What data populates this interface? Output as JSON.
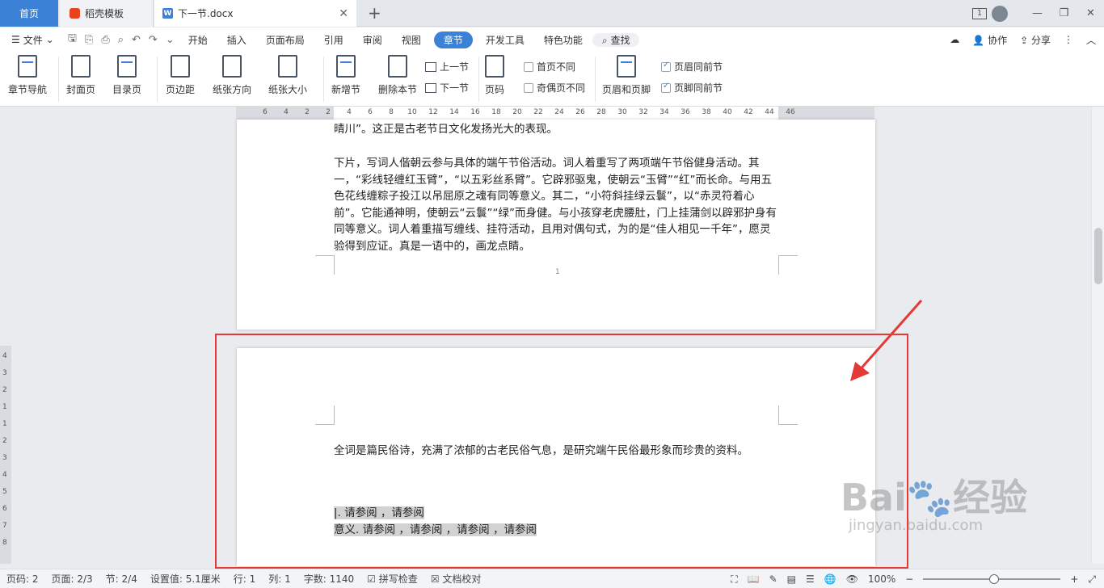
{
  "tabs": {
    "home": "首页",
    "docer": "稻壳模板",
    "doc": "下一节.docx",
    "close": "✕",
    "add": "+"
  },
  "window": {
    "badge": "1",
    "minimize": "—",
    "restore": "❐",
    "close": "✕"
  },
  "menu": {
    "file": "文件",
    "items": [
      "开始",
      "插入",
      "页面布局",
      "引用",
      "审阅",
      "视图",
      "章节",
      "开发工具",
      "特色功能"
    ],
    "search": "查找",
    "collab": "协作",
    "share": "分享",
    "more": "⋮",
    "collapse": "︿"
  },
  "ribbon": {
    "section_nav": "章节导航",
    "cover": "封面页",
    "toc": "目录页",
    "margins": "页边距",
    "orientation": "纸张方向",
    "size": "纸张大小",
    "new_section": "新增节",
    "delete_section": "删除本节",
    "prev_section": "上一节",
    "next_section": "下一节",
    "page_number": "页码",
    "first_page_diff": "首页不同",
    "odd_even_diff": "奇偶页不同",
    "header_footer": "页眉和页脚",
    "header_same": "页眉同前节",
    "footer_same": "页脚同前节"
  },
  "ruler": {
    "numbers": [
      "6",
      "4",
      "2",
      "2",
      "4",
      "6",
      "8",
      "10",
      "12",
      "14",
      "16",
      "18",
      "20",
      "22",
      "24",
      "26",
      "28",
      "30",
      "32",
      "34",
      "36",
      "38",
      "40",
      "42",
      "44",
      "46"
    ],
    "vertical": [
      "4",
      "3",
      "2",
      "1",
      "1",
      "2",
      "3",
      "4",
      "5",
      "6",
      "7",
      "8"
    ]
  },
  "document": {
    "top_fragment": "晴川”。这正是古老节日文化发扬光大的表现。",
    "paragraph": "下片，写词人偕朝云参与具体的端午节俗活动。词人着重写了两项端午节俗健身活动。其一，“彩线轻缠红玉臂”，“以五彩丝系臂”。它辟邪驱鬼，使朝云“玉臂”“红”而长命。与用五色花线缠粽子投江以吊屈原之魂有同等意义。其二，“小符斜挂绿云鬟”，以“赤灵符着心前”。它能通神明，使朝云“云鬟”“绿”而身健。与小孩穿老虎腰肚，门上挂蒲剑以辟邪护身有同等意义。词人着重描写缠线、挂符活动，且用对偶句式，为的是“佳人相见一千年”，愿灵验得到应证。真是一语中的，画龙点睛。",
    "page_mark": "1",
    "summary": "全词是篇民俗诗，充满了浓郁的古老民俗气息，是研究端午民俗最形象而珍贵的资料。",
    "ref_line1": "|. 请参阅 ，请参阅",
    "ref_line2": "意义. 请参阅 ，请参阅 ，请参阅 ，请参阅"
  },
  "watermark": {
    "brand": "Bai",
    "brand2": "经验",
    "url": "jingyan.baidu.com"
  },
  "status": {
    "page_code": "页码: 2",
    "page": "页面: 2/3",
    "section": "节: 2/4",
    "setting": "设置值: 5.1厘米",
    "row": "行: 1",
    "col": "列: 1",
    "words": "字数: 1140",
    "spell": "拼写检查",
    "proof": "文档校对",
    "zoom": "100%",
    "zoom_out": "−",
    "zoom_in": "+"
  },
  "colors": {
    "accent": "#3b82d6",
    "highlight_box": "#e53935"
  }
}
